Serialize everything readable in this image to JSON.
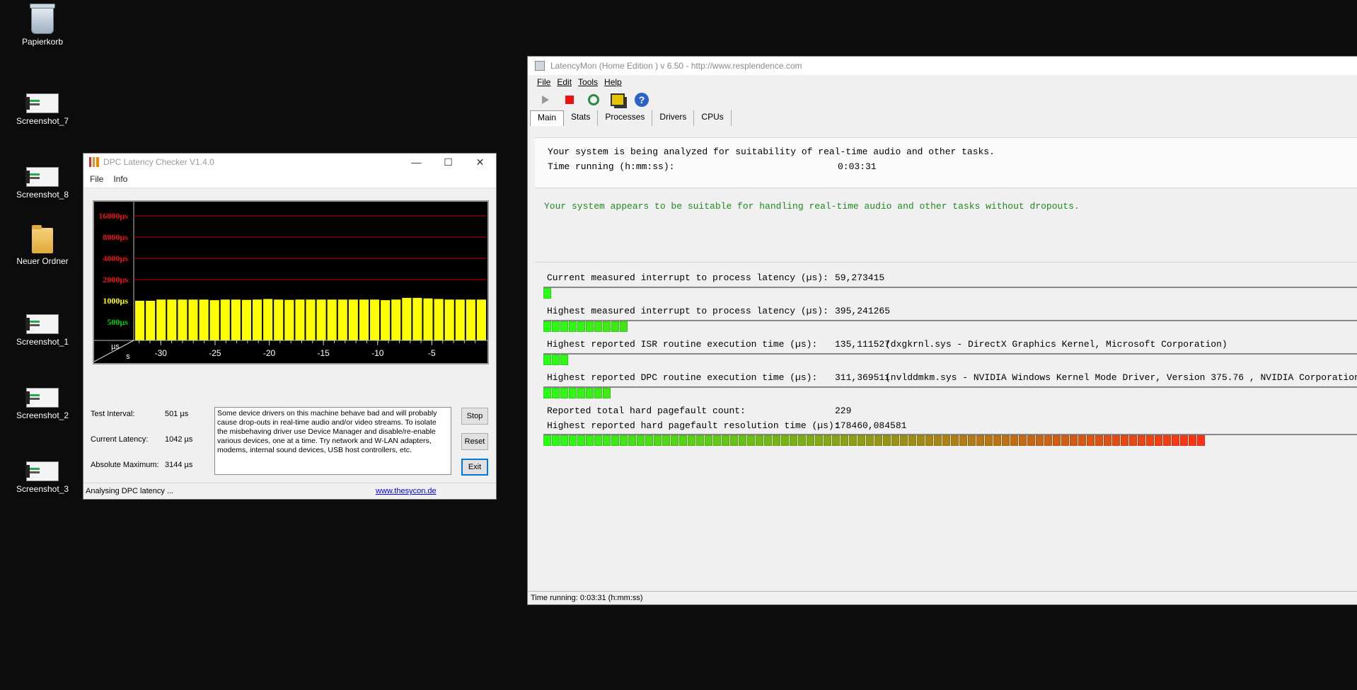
{
  "desktop": {
    "icons": [
      {
        "label": "Papierkorb",
        "icon": "recycle-bin-icon"
      },
      {
        "label": "Screenshot_7",
        "icon": "shortcut-icon"
      },
      {
        "label": "Screenshot_8",
        "icon": "shortcut-icon"
      },
      {
        "label": "Neuer Ordner",
        "icon": "folder-icon"
      },
      {
        "label": "Screenshot_1",
        "icon": "shortcut-icon"
      },
      {
        "label": "Screenshot_2",
        "icon": "shortcut-icon"
      },
      {
        "label": "Screenshot_3",
        "icon": "shortcut-icon"
      }
    ]
  },
  "dpc": {
    "title": "DPC Latency Checker V1.4.0",
    "menu": [
      "File",
      "Info"
    ],
    "stats": {
      "interval_label": "Test Interval:",
      "interval_value": "501 µs",
      "current_label": "Current Latency:",
      "current_value": "1042 µs",
      "max_label": "Absolute Maximum:",
      "max_value": "3144 µs"
    },
    "message": "Some device drivers on this machine behave bad and will probably cause drop-outs in real-time audio and/or video streams. To isolate the misbehaving driver use Device Manager and disable/re-enable various devices, one at a time. Try network and W-LAN adapters, modems, internal sound devices, USB host controllers, etc.",
    "buttons": {
      "stop": "Stop",
      "reset": "Reset",
      "exit": "Exit"
    },
    "status": "Analysing DPC latency ...",
    "link": "www.thesycon.de",
    "colors": {
      "bar": "#ffff00",
      "grid": "#cc0000",
      "green_label": "#00cc00"
    }
  },
  "chart_data": {
    "type": "bar",
    "ylabel": "µs",
    "xlabel": "s",
    "ytick_labels": [
      "16000µs",
      "8000µs",
      "4000µs",
      "2000µs",
      "1000µs",
      "500µs"
    ],
    "xtick_labels": [
      "-30",
      "-25",
      "-20",
      "-15",
      "-10",
      "-5"
    ],
    "x": [
      -32,
      -31,
      -30,
      -29,
      -28,
      -27,
      -26,
      -25,
      -24,
      -23,
      -22,
      -21,
      -20,
      -19,
      -18,
      -17,
      -16,
      -15,
      -14,
      -13,
      -12,
      -11,
      -10,
      -9,
      -8,
      -7,
      -6,
      -5,
      -4,
      -3,
      -2,
      -1
    ],
    "values": [
      1000,
      1000,
      1040,
      1040,
      1040,
      1040,
      1040,
      1020,
      1040,
      1040,
      1030,
      1040,
      1060,
      1040,
      1030,
      1040,
      1040,
      1040,
      1040,
      1040,
      1040,
      1040,
      1040,
      1020,
      1040,
      1100,
      1100,
      1080,
      1060,
      1040,
      1040,
      1040,
      1040
    ],
    "scale": "log2"
  },
  "lm": {
    "title": "LatencyMon  (Home Edition )  v 6.50 - http://www.resplendence.com",
    "menu": [
      "File",
      "Edit",
      "Tools",
      "Help"
    ],
    "tabs": [
      "Main",
      "Stats",
      "Processes",
      "Drivers",
      "CPUs"
    ],
    "analyzing": "Your system is being analyzed for suitability of real-time audio and other tasks.",
    "time_label": "Time running (h:mm:ss):",
    "time_value": "0:03:31",
    "verdict": "Your system appears to be suitable for handling real-time audio and other tasks without dropouts.",
    "rows": [
      {
        "label": "Current measured interrupt to process latency (µs):",
        "value": "59,273415",
        "extra": ""
      },
      {
        "label": "Highest measured interrupt to process latency (µs):",
        "value": "395,241265",
        "extra": ""
      },
      {
        "label": "Highest reported ISR routine execution time (µs):",
        "value": "135,111527",
        "extra": "(dxgkrnl.sys - DirectX Graphics Kernel, Microsoft Corporation)"
      },
      {
        "label": "Highest reported DPC routine execution time (µs):",
        "value": "311,369511",
        "extra": "(nvlddmkm.sys - NVIDIA Windows Kernel Mode Driver, Version 375.76 , NVIDIA Corporation)"
      },
      {
        "label": "Reported total hard pagefault count:",
        "value": "229",
        "extra": ""
      },
      {
        "label": "Highest reported hard pagefault resolution time (µs):",
        "value": "178460,084581",
        "extra": ""
      }
    ],
    "bars": {
      "current_segments": 1,
      "highest_segments": 10,
      "isr_segments": 3,
      "dpc_segments": 8,
      "pagefault_segments": 78
    },
    "status": "Time running: 0:03:31  (h:mm:ss)"
  }
}
